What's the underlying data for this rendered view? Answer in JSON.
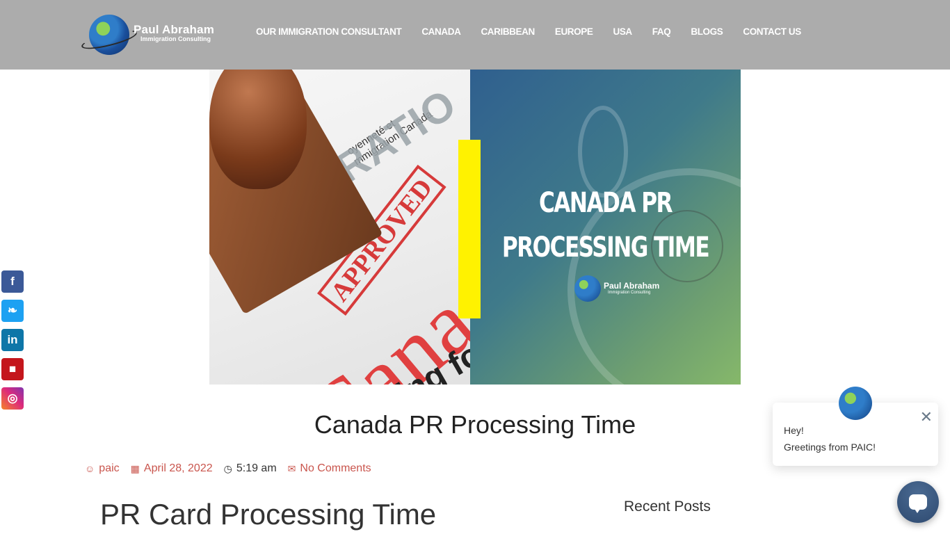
{
  "header": {
    "logo": {
      "name": "Paul Abraham",
      "subtitle": "Immigration Consulting"
    },
    "nav": [
      {
        "label": "OUR IMMIGRATION CONSULTANT"
      },
      {
        "label": "CANADA"
      },
      {
        "label": "CARIBBEAN"
      },
      {
        "label": "EUROPE"
      },
      {
        "label": "USA"
      },
      {
        "label": "FAQ"
      },
      {
        "label": "BLOGS"
      },
      {
        "label": "CONTACT US"
      }
    ]
  },
  "hero": {
    "title_line1": "CANADA PR",
    "title_line2": "PROCESSING TIME",
    "logo_name": "Paul Abraham",
    "logo_sub": "Immigration Consulting",
    "photo": {
      "doc_text_line1": "oyenneté et",
      "doc_text_line2": "mmigration Canada",
      "watermark": "IMMIGRATIO",
      "stamp": "APPROVED",
      "country": "Canad",
      "doc_bottom": "ing for a"
    },
    "accent_color": "#fff200"
  },
  "social": [
    {
      "name": "facebook",
      "glyph": "f",
      "color": "#3b5998"
    },
    {
      "name": "twitter",
      "glyph": "❧",
      "color": "#1da1f2"
    },
    {
      "name": "linkedin",
      "glyph": "in",
      "color": "#0e76a8"
    },
    {
      "name": "youtube",
      "glyph": "■",
      "color": "#c4161c"
    },
    {
      "name": "instagram",
      "glyph": "◎",
      "color": "#dd2a7b"
    }
  ],
  "post": {
    "title": "Canada PR Processing Time",
    "meta": {
      "author_icon": "☺",
      "author": "paic",
      "date_icon": "▦",
      "date": "April 28, 2022",
      "time_icon": "◷",
      "time": "5:19 am",
      "comments_icon": "✉",
      "comments": "No Comments"
    },
    "content_heading": "PR Card Processing Time"
  },
  "sidebar": {
    "recent_posts_heading": "Recent Posts"
  },
  "chat": {
    "close_icon": "✕",
    "line1": "Hey!",
    "line2": "Greetings from PAIC!"
  }
}
